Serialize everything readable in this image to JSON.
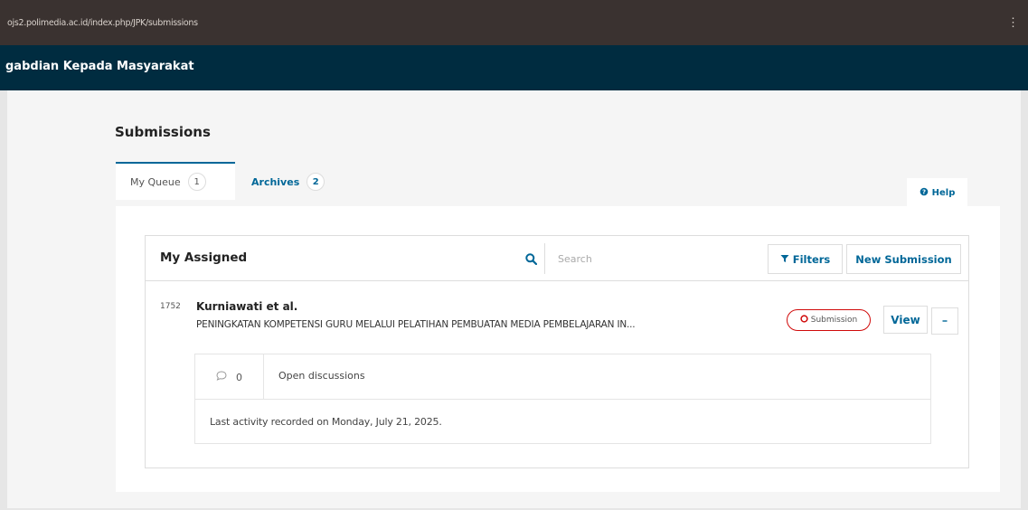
{
  "browser": {
    "url": "ojs2.polimedia.ac.id/index.php/JPK/submissions",
    "menu_glyph": "⋮"
  },
  "header": {
    "site_name": "gabdian Kepada Masyarakat"
  },
  "page": {
    "title": "Submissions"
  },
  "tabs": [
    {
      "label": "My Queue",
      "count": "1",
      "active": true
    },
    {
      "label": "Archives",
      "count": "2",
      "active": false
    }
  ],
  "help": {
    "label": "Help",
    "icon": "help-circle-icon"
  },
  "list": {
    "title": "My Assigned",
    "search": {
      "placeholder": "Search",
      "icon": "search-icon"
    },
    "filters_label": "Filters",
    "new_submission_label": "New Submission",
    "items": [
      {
        "id": "1752",
        "author": "Kurniawati et al.",
        "title": "PENINGKATAN KOMPETENSI GURU MELALUI PELATIHAN PEMBUATAN MEDIA PEMBELAJARAN IN...",
        "stage": "Submission",
        "view_label": "View",
        "discussions_count": "0",
        "discussions_label": "Open discussions",
        "activity": "Last activity recorded on Monday, July 21, 2025."
      }
    ]
  },
  "colors": {
    "primary": "#006798",
    "header": "#002c40",
    "stage": "#d00a0a"
  }
}
